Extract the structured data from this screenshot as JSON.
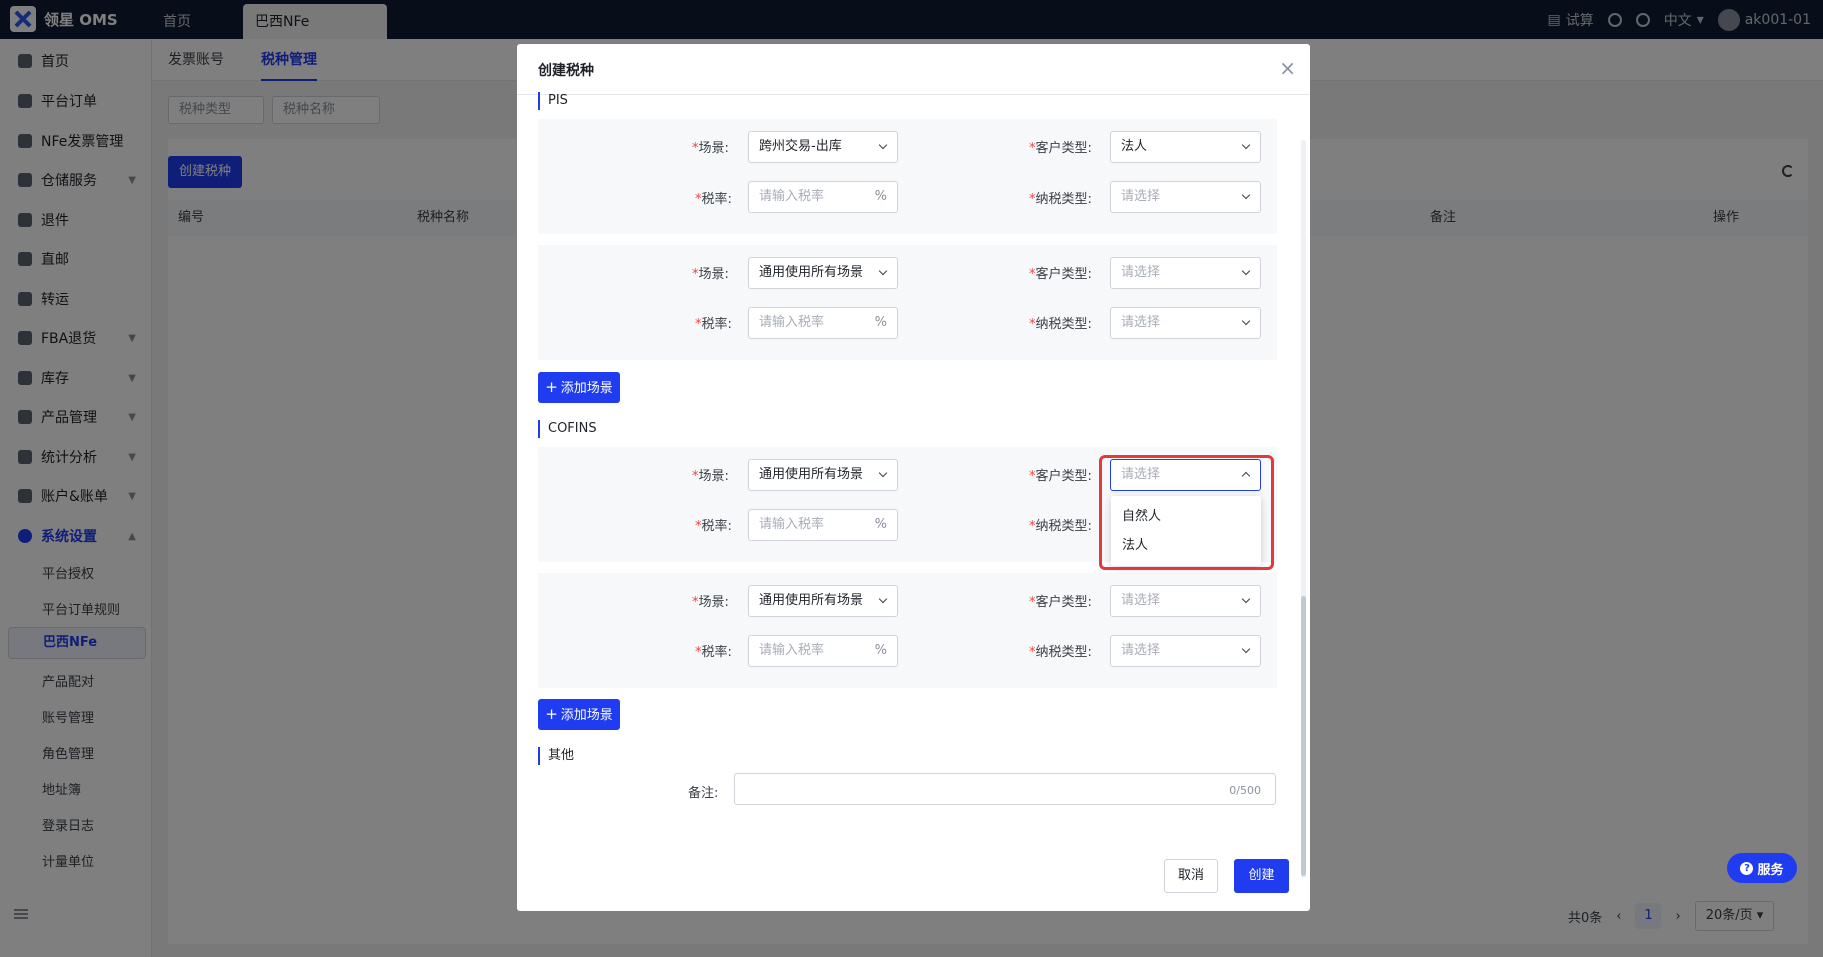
{
  "app": {
    "logo_text": "领星 OMS"
  },
  "topbar": {
    "tabs": [
      "首页",
      "巴西NFe"
    ],
    "trial_label": "试算",
    "language": "中文",
    "username": "ak001-01"
  },
  "sidebar": {
    "items": [
      {
        "label": "首页"
      },
      {
        "label": "平台订单"
      },
      {
        "label": "NFe发票管理"
      },
      {
        "label": "仓储服务"
      },
      {
        "label": "退件"
      },
      {
        "label": "直邮"
      },
      {
        "label": "转运"
      },
      {
        "label": "FBA退货"
      },
      {
        "label": "库存"
      },
      {
        "label": "产品管理"
      },
      {
        "label": "统计分析"
      },
      {
        "label": "账户&账单"
      },
      {
        "label": "系统设置"
      }
    ],
    "subitems": [
      "平台授权",
      "平台订单规则",
      "巴西NFe",
      "产品配对",
      "账号管理",
      "角色管理",
      "地址簿",
      "登录日志",
      "计量单位"
    ]
  },
  "page": {
    "subtabs": [
      "发票账号",
      "税种管理"
    ],
    "filters": [
      "税种类型",
      "税种名称"
    ],
    "create_button": "创建税种",
    "table_headers": [
      "编号",
      "税种名称",
      "备注",
      "操作"
    ],
    "pager": {
      "total": "共0条",
      "page": "1",
      "page_size": "20条/页"
    }
  },
  "service_button": "服务",
  "modal": {
    "title": "创建税种",
    "labels": {
      "scene": "场景:",
      "customer_type": "客户类型:",
      "rate": "税率:",
      "tax_type": "纳税类型:",
      "remark": "备注:"
    },
    "required_mark": "*",
    "placeholders": {
      "select": "请选择",
      "rate": "请输入税率"
    },
    "percent": "%",
    "add_scene": "添加场景",
    "sections": {
      "pis": {
        "title": "PIS",
        "cards": [
          {
            "scene": "跨州交易-出库",
            "customer_type": "法人"
          },
          {
            "scene": "通用使用所有场景"
          }
        ]
      },
      "cofins": {
        "title": "COFINS",
        "cards": [
          {
            "scene": "通用使用所有场景"
          },
          {
            "scene": "通用使用所有场景"
          }
        ]
      },
      "other": {
        "title": "其他"
      }
    },
    "dropdown_options": [
      "自然人",
      "法人"
    ],
    "remark_count": "0/500",
    "cancel": "取消",
    "create": "创建"
  }
}
